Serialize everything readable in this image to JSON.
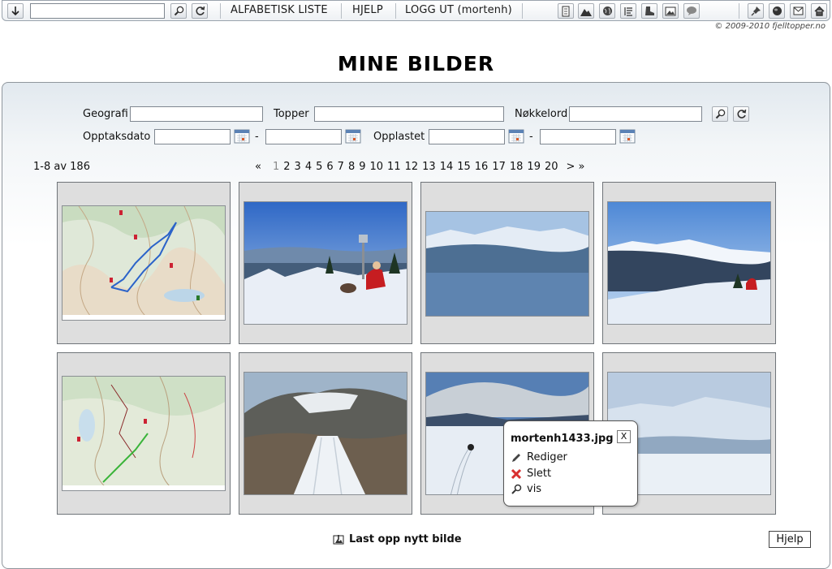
{
  "toolbar": {
    "links": [
      "ALFABETISK LISTE",
      "HJELP",
      "LOGG UT (mortenh)"
    ],
    "search_value": "",
    "icons_left": [
      "down-arrow-icon",
      "search-icon",
      "refresh-icon"
    ],
    "icons_right": [
      "document-icon",
      "mountain-icon",
      "globe-icon",
      "list-icon",
      "boot-icon",
      "picture-icon",
      "speech-bubble-icon",
      "pin-icon",
      "world-icon",
      "mail-icon",
      "home-icon"
    ]
  },
  "copyright": "© 2009-2010 fjelltopper.no",
  "page_title": "MINE BILDER",
  "filters": {
    "geografi_label": "Geografi",
    "topper_label": "Topper",
    "nokkelord_label": "Nøkkelord",
    "opptaksdato_label": "Opptaksdato",
    "opplastet_label": "Opplastet",
    "dash": "-"
  },
  "paging": {
    "count": "1-8 av 186",
    "first": "«",
    "pages": [
      "1",
      "2",
      "3",
      "4",
      "5",
      "6",
      "7",
      "8",
      "9",
      "10",
      "11",
      "12",
      "13",
      "14",
      "15",
      "16",
      "17",
      "18",
      "19",
      "20"
    ],
    "next": "> »"
  },
  "thumbnails": [
    {
      "kind": "map",
      "desc": "map"
    },
    {
      "kind": "snow-person"
    },
    {
      "kind": "blue-mountains"
    },
    {
      "kind": "snow-ridge"
    },
    {
      "kind": "map2"
    },
    {
      "kind": "road"
    },
    {
      "kind": "tracks"
    },
    {
      "kind": "plateau"
    }
  ],
  "popup": {
    "filename": "mortenh1433.jpg",
    "close": "X",
    "actions": [
      "Rediger",
      "Slett",
      "vis"
    ]
  },
  "upload_label": "Last opp nytt bilde",
  "help_label": "Hjelp",
  "colors": {
    "panel_border": "#8f969d",
    "thumb_bg": "#dedede",
    "delete_red": "#d83030"
  }
}
